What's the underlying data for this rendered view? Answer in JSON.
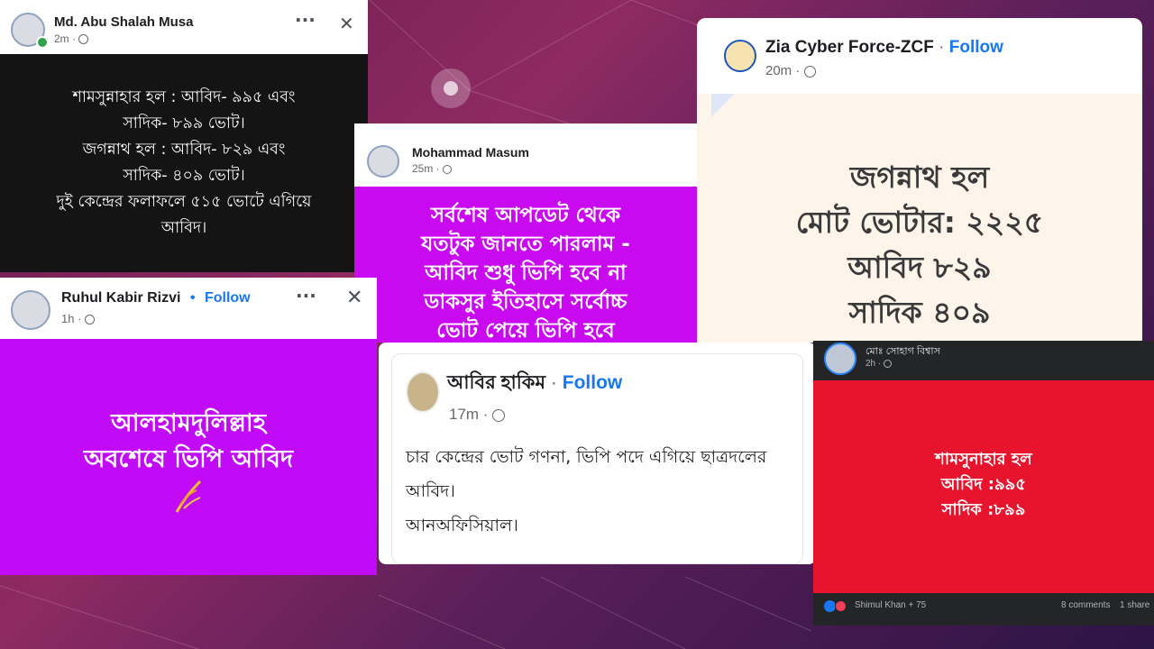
{
  "posts": {
    "musa": {
      "author": "Md. Abu Shalah Musa",
      "time": "2m",
      "more_icon": "···",
      "close_icon": "✕",
      "lines": [
        "শামসুন্নাহার হল : আবিদ- ৯৯৫ এবং",
        "সাদিক- ৮৯৯ ভোট।",
        "জগন্নাথ হল : আবিদ- ৮২৯ এবং",
        "সাদিক- ৪০৯ ভোট।",
        "দুই কেন্দ্রের ফলাফলে ৫১৫ ভোটে এগিয়ে",
        "আবিদ।"
      ],
      "bg": "#141414"
    },
    "masum": {
      "author": "Mohammad Masum",
      "time": "25m",
      "lines": [
        "সর্বশেষ আপডেট থেকে",
        "যতটুক জানতে পারলাম -",
        "আবিদ শুধু ভিপি হবে না",
        "ডাকসুর ইতিহাসে সর্বোচ্চ",
        "ভোট পেয়ে ভিপি হবে"
      ],
      "bg": "#c90af0"
    },
    "zcf": {
      "author": "Zia Cyber Force-ZCF",
      "follow": "Follow",
      "separator": "·",
      "time": "20m",
      "lines": [
        "জগন্নাথ হল",
        "মোট ভোটার: ২২২৫",
        "আবিদ ৮২৯",
        "সাদিক ৪০৯"
      ],
      "bg": "#fdf4ea"
    },
    "rizvi": {
      "author": "Ruhul Kabir Rizvi",
      "follow": "Follow",
      "separator": "•",
      "time": "1h",
      "more_icon": "···",
      "close_icon": "✕",
      "lines": [
        "আলহামদুলিল্লাহ",
        "অবশেষে ভিপি আবিদ"
      ],
      "bg": "#c10af5"
    },
    "abir": {
      "author": "আবির হাকিম",
      "follow": "Follow",
      "separator": "·",
      "time": "17m",
      "lines": [
        "চার কেন্দ্রের ভোট গণনা, ভিপি পদে এগিয়ে ছাত্রদলের",
        "আবিদ।",
        "আনঅফিসিয়াল।"
      ]
    },
    "sohag": {
      "author": "মোঃ সোহাগ বিশ্বাস",
      "time": "2h",
      "lines": [
        "শামসুনাহার হল",
        "আবিদ :৯৯৫",
        "সাদিক :৮৯৯"
      ],
      "reactions": "Shimul Khan + 75",
      "comments": "8 comments",
      "shares": "1 share",
      "bg": "#e8132d"
    }
  },
  "colors": {
    "accent": "#1877f2",
    "meta": "#65676b"
  }
}
